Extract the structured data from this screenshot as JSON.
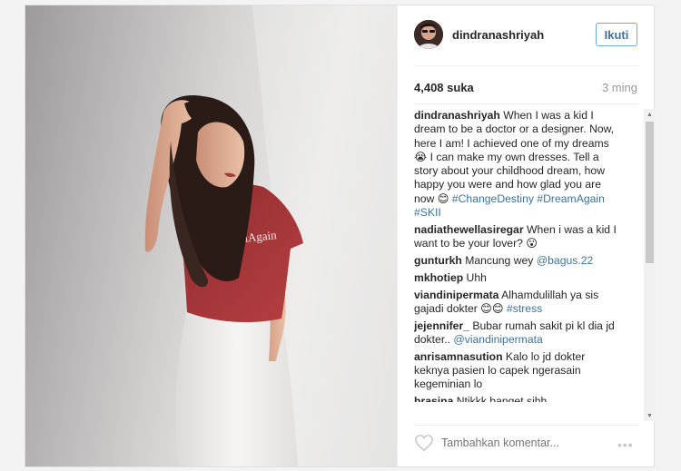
{
  "post": {
    "username": "dindranashriyah",
    "follow_label": "Ikuti",
    "likes": "4,408 suka",
    "time_ago": "3 ming",
    "shirt_text": "...eamAgain",
    "comments": [
      {
        "user": "dindranashriyah",
        "parts": [
          {
            "t": "text",
            "v": " When I was a kid I dream to be a doctor or a designer. Now, here I am! I achieved one of my dreams 😭 I can make my own dresses. Tell a story about your childhood dream, how happy you were and how glad you are now 😊 "
          },
          {
            "t": "tag",
            "v": "#ChangeDestiny"
          },
          {
            "t": "text",
            "v": " "
          },
          {
            "t": "tag",
            "v": "#DreamAgain"
          },
          {
            "t": "text",
            "v": " "
          },
          {
            "t": "tag",
            "v": "#SKII"
          }
        ]
      },
      {
        "user": "nadiathewellasiregar",
        "parts": [
          {
            "t": "text",
            "v": " When i was a kid I want to be your lover? 😮"
          }
        ]
      },
      {
        "user": "gunturkh",
        "parts": [
          {
            "t": "text",
            "v": " Mancung wey "
          },
          {
            "t": "tag",
            "v": "@bagus.22"
          }
        ]
      },
      {
        "user": "mkhotiep",
        "parts": [
          {
            "t": "text",
            "v": " Uhh"
          }
        ]
      },
      {
        "user": "viandinipermata",
        "parts": [
          {
            "t": "text",
            "v": " Alhamdulillah ya sis gajadi dokter 😊😊 "
          },
          {
            "t": "tag",
            "v": "#stress"
          }
        ]
      },
      {
        "user": "jejennifer_",
        "parts": [
          {
            "t": "text",
            "v": " Bubar rumah sakit pi kl dia jd dokter.. "
          },
          {
            "t": "tag",
            "v": "@viandinipermata"
          }
        ]
      },
      {
        "user": "anrisamnasution",
        "parts": [
          {
            "t": "text",
            "v": " Kalo lo jd dokter keknya pasien lo capek ngerasain kegeminian lo"
          }
        ]
      },
      {
        "user": "hrasina",
        "parts": [
          {
            "t": "text",
            "v": " Ntikkk banget sihh"
          }
        ]
      }
    ],
    "comment_placeholder": "Tambahkan komentar...",
    "more_options": "•••",
    "scroll_up": "▲",
    "scroll_down": "▼",
    "icons": [
      "heart-icon",
      "more-options-icon"
    ],
    "colors": {
      "follow_border": "#70a7db",
      "follow_text": "#3f729b",
      "hashtag": "#3f729b",
      "placeholder": "#a5a7aa"
    }
  }
}
